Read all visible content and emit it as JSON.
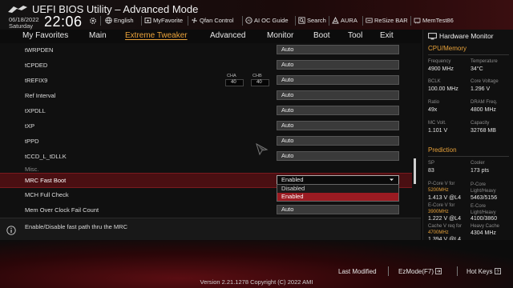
{
  "header": {
    "title": "UEFI BIOS Utility – Advanced Mode",
    "date": "06/18/2022",
    "day": "Saturday",
    "time": "22:06",
    "tools": [
      {
        "label": "English",
        "icon": "globe-icon"
      },
      {
        "label": "MyFavorite",
        "icon": "favorite-icon"
      },
      {
        "label": "Qfan Control",
        "icon": "fan-icon"
      },
      {
        "label": "AI OC Guide",
        "icon": "ai-icon"
      },
      {
        "label": "Search",
        "icon": "search-icon"
      },
      {
        "label": "AURA",
        "icon": "aura-icon"
      },
      {
        "label": "ReSize BAR",
        "icon": "resize-bar-icon"
      },
      {
        "label": "MemTest86",
        "icon": "memtest-icon"
      }
    ]
  },
  "menu": {
    "items": [
      "My Favorites",
      "Main",
      "Extreme Tweaker",
      "Advanced",
      "Monitor",
      "Boot",
      "Tool",
      "Exit"
    ],
    "active": "Extreme Tweaker"
  },
  "settings": [
    {
      "label": "tWRPDEN",
      "value": "Auto"
    },
    {
      "label": "tCPDED",
      "value": "Auto"
    },
    {
      "label": "tREFIX9",
      "value": "Auto",
      "channels": [
        {
          "name": "CHA",
          "value": "40"
        },
        {
          "name": "CHB",
          "value": "40"
        }
      ]
    },
    {
      "label": "Ref Interval",
      "value": "Auto"
    },
    {
      "label": "tXPDLL",
      "value": "Auto"
    },
    {
      "label": "tXP",
      "value": "Auto"
    },
    {
      "label": "tPPD",
      "value": "Auto"
    },
    {
      "label": "tCCD_L_tDLLK",
      "value": "Auto"
    },
    {
      "label": "Misc.",
      "value": ""
    },
    {
      "label": "MRC Fast Boot",
      "value": "Enabled"
    },
    {
      "label": "MCH Full Check",
      "value": ""
    },
    {
      "label": "Mem Over Clock Fail Count",
      "value": "Auto"
    }
  ],
  "dropdown": {
    "options": [
      "Disabled",
      "Enabled"
    ],
    "selected": "Enabled"
  },
  "help": {
    "text": "Enable/Disable fast path thru the MRC"
  },
  "hardware_monitor": {
    "title": "Hardware Monitor",
    "cpu_memory": {
      "title": "CPU/Memory",
      "frequency": {
        "label": "Frequency",
        "value": "4900 MHz"
      },
      "temperature": {
        "label": "Temperature",
        "value": "34°C"
      },
      "bclk": {
        "label": "BCLK",
        "value": "100.00 MHz"
      },
      "core_voltage": {
        "label": "Core Voltage",
        "value": "1.296 V"
      },
      "ratio": {
        "label": "Ratio",
        "value": "49x"
      },
      "dram_freq": {
        "label": "DRAM Freq.",
        "value": "4800 MHz"
      },
      "mc_volt": {
        "label": "MC Volt.",
        "value": "1.101 V"
      },
      "capacity": {
        "label": "Capacity",
        "value": "32768 MB"
      }
    },
    "prediction": {
      "title": "Prediction",
      "sp": {
        "label": "SP",
        "value": "83"
      },
      "cooler": {
        "label": "Cooler",
        "value": "173 pts"
      },
      "pcore_v_label": "P-Core V for",
      "pcore_v_freq": "5200MHz",
      "pcore_v_value": "1.413 V @L4",
      "pcore_lh_label": "P-Core Light/Heavy",
      "pcore_lh_value": "5463/5156",
      "ecore_v_label": "E-Core V for",
      "ecore_v_freq": "3900MHz",
      "ecore_v_value": "1.222 V @L4",
      "ecore_lh_label": "E-Core Light/Heavy",
      "ecore_lh_value": "4100/3860",
      "cache_v_label": "Cache V req for",
      "cache_v_freq": "4700MHz",
      "cache_v_value": "1.394 V @L4",
      "heavy_cache_label": "Heavy Cache",
      "heavy_cache_value": "4304 MHz"
    }
  },
  "footer": {
    "last_modified": "Last Modified",
    "ezmode": "EzMode(F7)",
    "hotkeys": "Hot Keys",
    "version": "Version 2.21.1278 Copyright (C) 2022 AMI"
  },
  "colors": {
    "accent": "#e8a23a",
    "selection": "#9b1b22"
  }
}
